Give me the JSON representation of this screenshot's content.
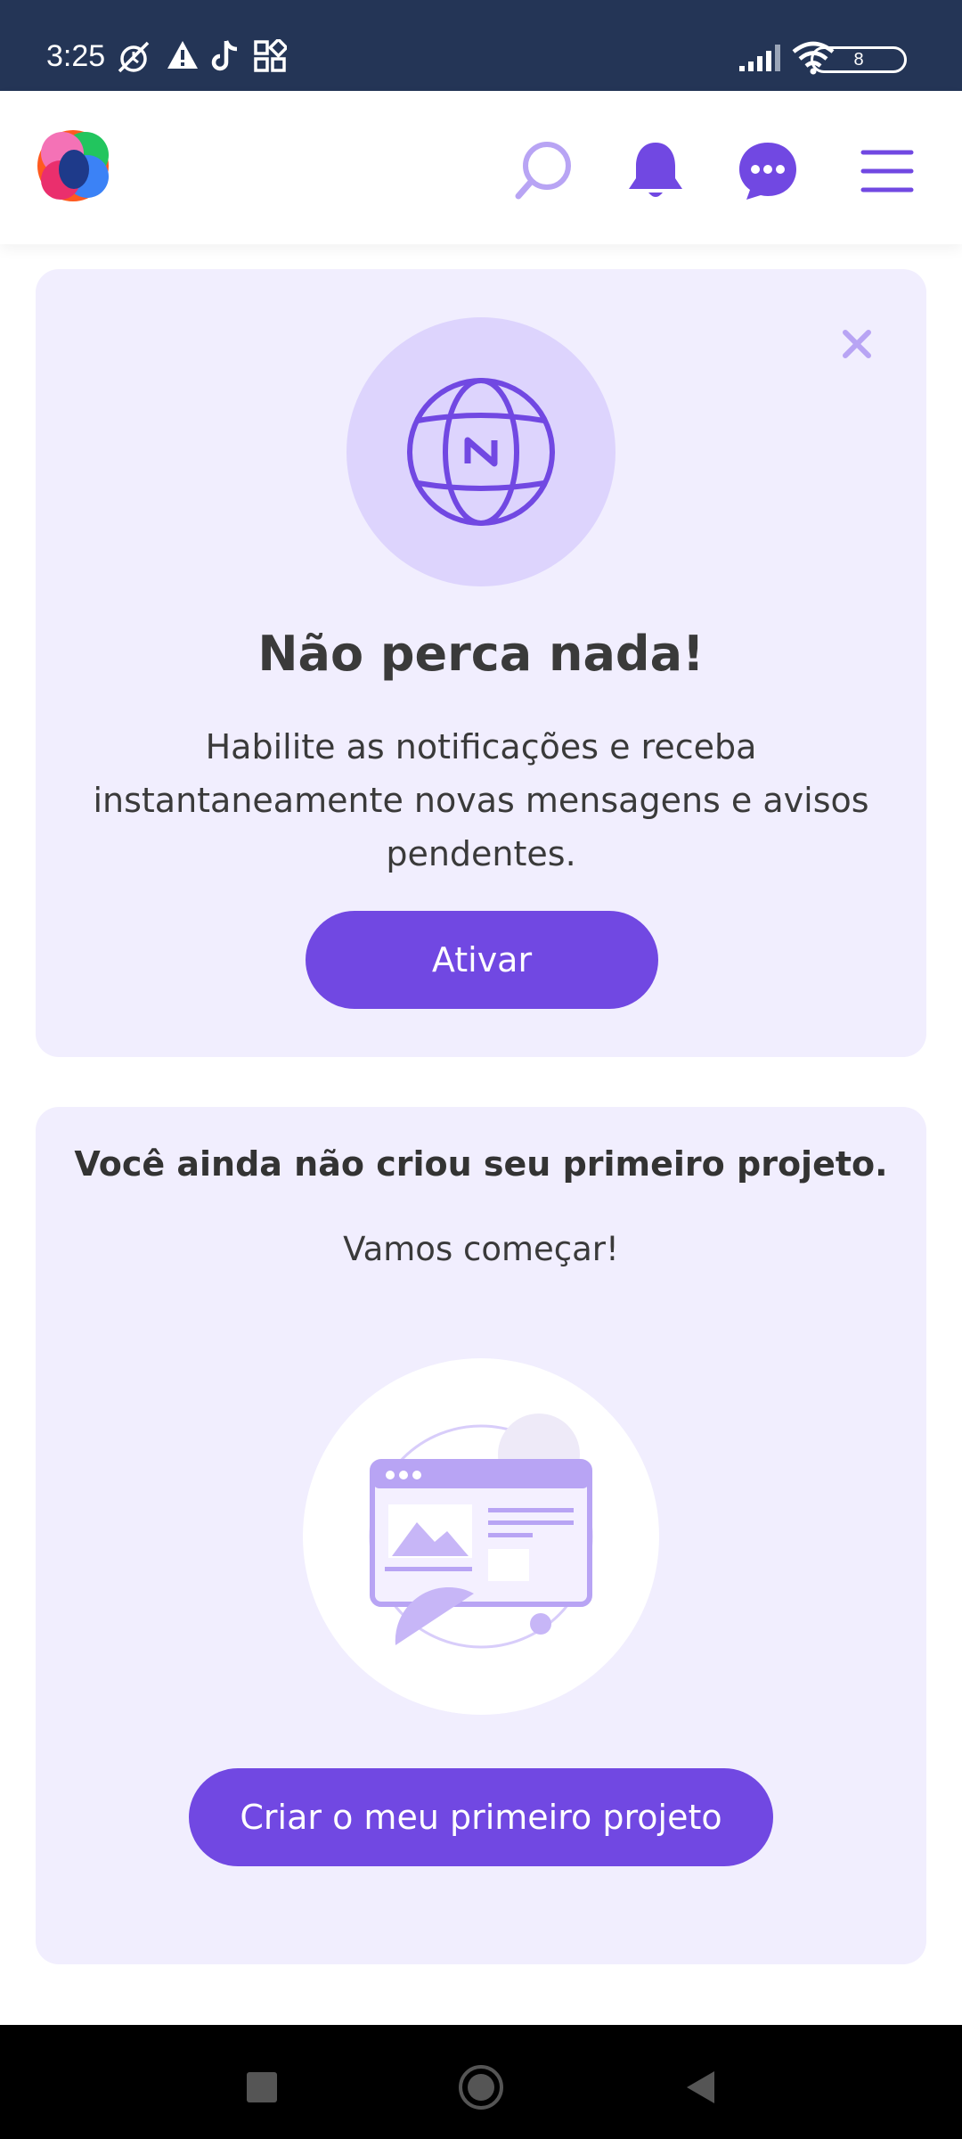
{
  "status_bar": {
    "time": "3:25",
    "battery_level": "8",
    "icons": [
      "muted-alarm-icon",
      "warning-icon",
      "tiktok-icon",
      "apps-grid-icon",
      "signal-icon",
      "wifi-icon",
      "battery-icon"
    ]
  },
  "header": {
    "logo": "app-logo",
    "icons": [
      "search-icon",
      "bell-icon",
      "chat-icon",
      "menu-icon"
    ]
  },
  "notification_card": {
    "title": "Não perca nada!",
    "description": "Habilite as notificações e receba instantaneamente novas mensagens e avisos pendentes.",
    "activate_label": "Ativar",
    "icons": [
      "close-icon",
      "globe-icon"
    ]
  },
  "project_card": {
    "title": "Você ainda não criou seu primeiro projeto.",
    "subtitle": "Vamos começar!",
    "create_label": "Criar o meu primeiro projeto",
    "illustration": "browser-window-illustration"
  },
  "nav_bar": {
    "icons": [
      "recents-icon",
      "home-icon",
      "back-icon"
    ]
  },
  "colors": {
    "status_bar_bg": "#243556",
    "accent": "#7148e2",
    "accent_light": "#ddd4fd",
    "card_bg": "#f1eefe",
    "icon_light": "#b8a4f4"
  }
}
